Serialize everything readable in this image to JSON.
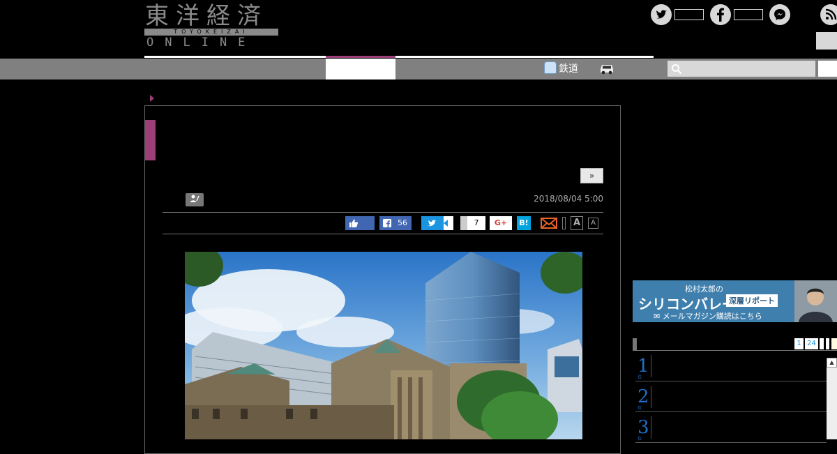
{
  "header": {
    "logo_kanji": "東洋経済",
    "logo_romaji": "TOYOKEIZAI",
    "logo_online": "ONLINE",
    "social_icons": [
      "twitter-icon",
      "facebook-icon",
      "messenger-icon",
      "rss-icon"
    ]
  },
  "nav": {
    "rail_label": "鉄道",
    "icons": [
      "train-icon",
      "car-icon",
      "search-icon"
    ],
    "search": {
      "placeholder": ""
    },
    "accent_color": "#9c3f78"
  },
  "article": {
    "next_button": "»",
    "date": "2018/08/04 5:00",
    "share": {
      "facebook_count": "56",
      "pocket_count": "7",
      "gplus_label": "G+",
      "hatena_label": "B!",
      "font_large": "A",
      "font_small": "A"
    }
  },
  "sidebar": {
    "banner": {
      "line1": "松村太郎の",
      "line2": "シリコンバレー",
      "line3": "深層リポート",
      "line4": "メールマガジン購読はこちら"
    },
    "ranking": {
      "pages": [
        "1",
        "24"
      ],
      "items": [
        {
          "rank": "1",
          "suffix": "位"
        },
        {
          "rank": "2",
          "suffix": "位"
        },
        {
          "rank": "3",
          "suffix": "位"
        }
      ],
      "scroll_up": "▲"
    }
  }
}
